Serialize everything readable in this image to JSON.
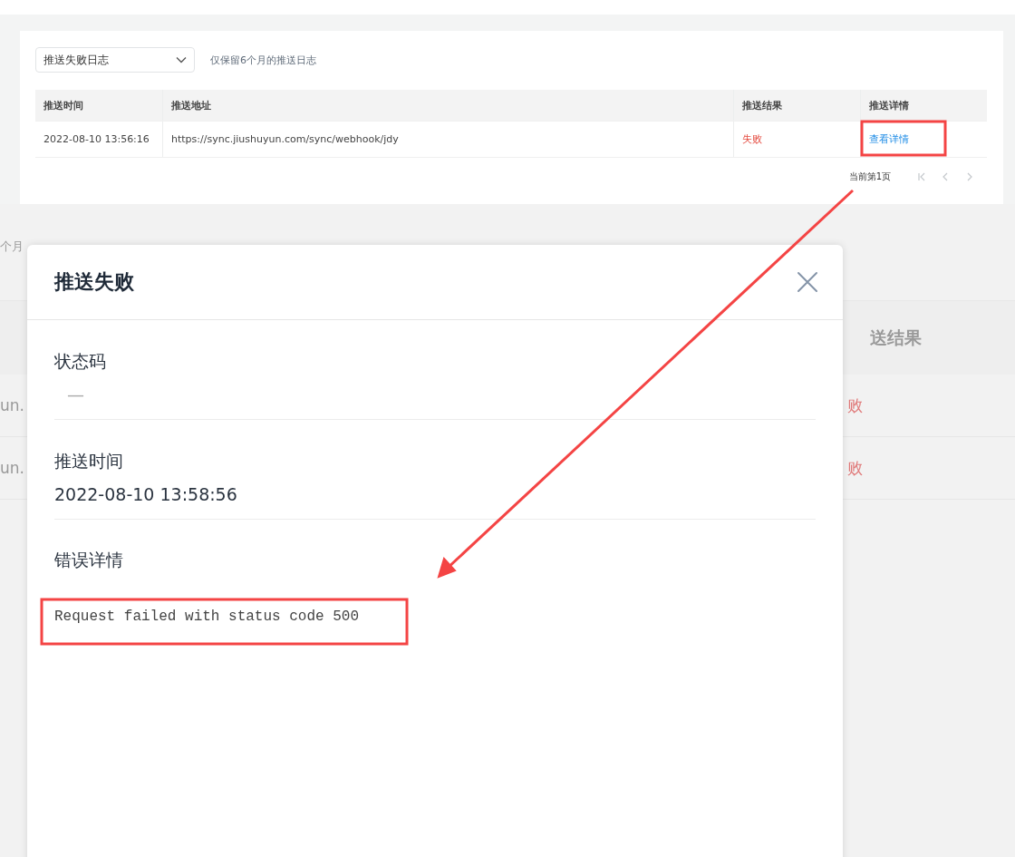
{
  "panel": {
    "log_select": {
      "value": "推送失败日志"
    },
    "hint": "仅保留6个月的推送日志",
    "table": {
      "columns": [
        "推送时间",
        "推送地址",
        "推送结果",
        "推送详情"
      ],
      "rows": [
        {
          "time": "2022-08-10 13:56:16",
          "url": "https://sync.jiushuyun.com/sync/webhook/jdy",
          "result": "失败",
          "failed": true,
          "detail_link": "查看详情"
        }
      ]
    },
    "pagination": {
      "label": "当前第1页",
      "buttons": [
        {
          "kind": "first",
          "disabled": true
        },
        {
          "kind": "prev",
          "disabled": true
        },
        {
          "kind": "next",
          "disabled": true
        }
      ]
    }
  },
  "background": {
    "hint_fragment": "个月",
    "header_fragment": "送结果",
    "rows": [
      {
        "url_fragment": "un.",
        "result_fragment": "败"
      },
      {
        "url_fragment": "un.",
        "result_fragment": "败"
      }
    ]
  },
  "dialog": {
    "title": "推送失败",
    "fields": [
      {
        "label": "状态码",
        "value": "—",
        "kind": "empty"
      },
      {
        "label": "推送时间",
        "value": "2022-08-10 13:58:56",
        "kind": "text"
      },
      {
        "label": "错误详情",
        "value": "Request failed with status code 500",
        "kind": "code"
      }
    ]
  }
}
